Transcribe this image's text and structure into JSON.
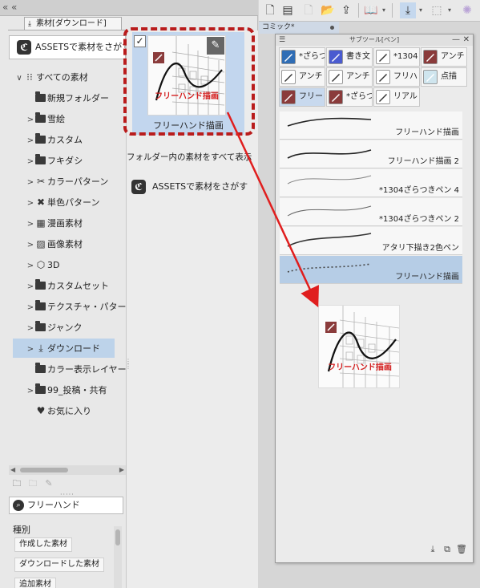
{
  "left_panel": {
    "tab_label": "素材[ダウンロード]",
    "assets_search_label": "ASSETSで素材をさがす",
    "tree": [
      {
        "label": "すべての素材",
        "chevron": "∨",
        "icon": "grid-icon"
      },
      {
        "label": "新規フォルダー",
        "chevron": "",
        "icon": "folder-icon"
      },
      {
        "label": "雪絵",
        "chevron": ">",
        "icon": "folder-icon"
      },
      {
        "label": "カスタム",
        "chevron": ">",
        "icon": "folder-icon"
      },
      {
        "label": "フキダシ",
        "chevron": ">",
        "icon": "folder-icon"
      },
      {
        "label": "カラーパターン",
        "chevron": ">",
        "icon": "color-pattern-icon"
      },
      {
        "label": "単色パターン",
        "chevron": ">",
        "icon": "mono-pattern-icon"
      },
      {
        "label": "漫画素材",
        "chevron": ">",
        "icon": "manga-icon"
      },
      {
        "label": "画像素材",
        "chevron": ">",
        "icon": "image-icon"
      },
      {
        "label": "3D",
        "chevron": ">",
        "icon": "cube-icon"
      },
      {
        "label": "カスタムセット",
        "chevron": ">",
        "icon": "folder-icon"
      },
      {
        "label": "テクスチャ・パターン",
        "chevron": ">",
        "icon": "folder-icon"
      },
      {
        "label": "ジャンク",
        "chevron": ">",
        "icon": "folder-icon"
      },
      {
        "label": "ダウンロード",
        "chevron": ">",
        "icon": "download-folder-icon"
      },
      {
        "label": "カラー表示レイヤー",
        "chevron": "",
        "icon": "folder-icon"
      },
      {
        "label": "99_投稿・共有",
        "chevron": ">",
        "icon": "folder-icon"
      },
      {
        "label": "お気に入り",
        "chevron": "",
        "icon": "heart-icon"
      }
    ],
    "selected_tree_index": 13,
    "tag_search_value": "フリーハンド",
    "type_label": "種別",
    "type_buttons": [
      "作成した素材",
      "ダウンロードした素材",
      "追加素材"
    ]
  },
  "material_list": {
    "item_label": "フリーハンド描画",
    "thumb_caption": "フリーハンド描画",
    "show_all_label": "フォルダー内の素材をすべて表示",
    "assets_search_label": "ASSETSで素材をさがす"
  },
  "canvas_tab": {
    "label": "コミック*"
  },
  "subtool_window": {
    "title": "サブツール[ペン]",
    "buttons": [
      {
        "label": "*ざらつ",
        "color": "#2f6db5"
      },
      {
        "label": "書き文",
        "color": "#4a5bd0"
      },
      {
        "label": "*1304",
        "color": "#ffffff"
      },
      {
        "label": "アンチ",
        "color": "#8a3b3b"
      },
      {
        "label": "アンチ",
        "color": "#ffffff"
      },
      {
        "label": "アンチ",
        "color": "#ffffff"
      },
      {
        "label": "フリハ",
        "color": "#ffffff"
      },
      {
        "label": "点描",
        "color": "#cfe5ee"
      },
      {
        "label": "フリー",
        "color": "#8a3b3b"
      },
      {
        "label": "*ざらつ",
        "color": "#8a3b3b"
      },
      {
        "label": "リアル",
        "color": "#ffffff"
      }
    ],
    "selected_button_index": 8,
    "brushes": [
      {
        "name": "フリーハンド描画",
        "stroke": "#222"
      },
      {
        "name": "フリーハンド描画 2",
        "stroke": "#222"
      },
      {
        "name": "*1304ざらつきペン 4",
        "stroke": "#888"
      },
      {
        "name": "*1304ざらつきペン 2",
        "stroke": "#666"
      },
      {
        "name": "アタリ下描き2色ペン",
        "stroke": "#333"
      },
      {
        "name": "フリーハンド描画",
        "stroke": "#444"
      }
    ],
    "selected_brush_index": 5
  },
  "thumbnail": {
    "caption_text": "フリーハンド描画",
    "caption_color": "#d42020"
  },
  "colors": {
    "selection_blue": "#bdd3ea",
    "annotation_red": "#b91c1c"
  }
}
